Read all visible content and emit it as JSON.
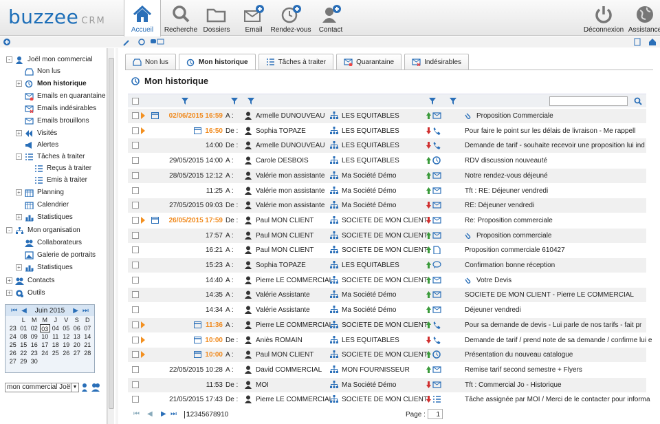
{
  "app": {
    "logo": "buzzee",
    "logo_suffix": "CRM"
  },
  "nav": [
    {
      "label": "Accueil",
      "icon": "home-icon"
    },
    {
      "label": "Recherche",
      "icon": "search-icon"
    },
    {
      "label": "Dossiers",
      "icon": "folder-icon"
    },
    {
      "label": "Email",
      "icon": "email-add-icon"
    },
    {
      "label": "Rendez-vous",
      "icon": "clock-add-icon"
    },
    {
      "label": "Contact",
      "icon": "contact-add-icon"
    }
  ],
  "nav_right": [
    {
      "label": "Déconnexion",
      "icon": "power-icon"
    },
    {
      "label": "Assistance",
      "icon": "globe-icon"
    }
  ],
  "sidebar": {
    "items": [
      {
        "label": "Joël mon commercial",
        "level": 0,
        "exp": "-",
        "icon": "user-icon"
      },
      {
        "label": "Non lus",
        "level": 1,
        "exp": "",
        "icon": "inbox-icon"
      },
      {
        "label": "Mon historique",
        "level": 1,
        "exp": "+",
        "icon": "history-icon",
        "bold": true
      },
      {
        "label": "Emails en quarantaine",
        "level": 1,
        "exp": "",
        "icon": "mail-quarantine-icon"
      },
      {
        "label": "Emails indésirables",
        "level": 1,
        "exp": "",
        "icon": "mail-spam-icon"
      },
      {
        "label": "Emails brouillons",
        "level": 1,
        "exp": "",
        "icon": "mail-draft-icon"
      },
      {
        "label": "Visités",
        "level": 1,
        "exp": "+",
        "icon": "back-icon"
      },
      {
        "label": "Alertes",
        "level": 1,
        "exp": "",
        "icon": "megaphone-icon"
      },
      {
        "label": "Tâches à traiter",
        "level": 1,
        "exp": "-",
        "icon": "list-icon"
      },
      {
        "label": "Reçus à traiter",
        "level": 2,
        "exp": "",
        "icon": "list-icon"
      },
      {
        "label": "Emis à traiter",
        "level": 2,
        "exp": "",
        "icon": "list-icon"
      },
      {
        "label": "Planning",
        "level": 1,
        "exp": "+",
        "icon": "calendar-icon"
      },
      {
        "label": "Calendrier",
        "level": 1,
        "exp": "",
        "icon": "calendar-icon"
      },
      {
        "label": "Statistiques",
        "level": 1,
        "exp": "+",
        "icon": "stats-icon"
      },
      {
        "label": "Mon organisation",
        "level": 0,
        "exp": "-",
        "icon": "org-icon"
      },
      {
        "label": "Collaborateurs",
        "level": 1,
        "exp": "",
        "icon": "users-icon"
      },
      {
        "label": "Galerie de portraits",
        "level": 1,
        "exp": "",
        "icon": "gallery-icon"
      },
      {
        "label": "Statistiques",
        "level": 1,
        "exp": "+",
        "icon": "stats-icon"
      },
      {
        "label": "Contacts",
        "level": 0,
        "exp": "+",
        "icon": "contacts-icon"
      },
      {
        "label": "Outils",
        "level": 0,
        "exp": "+",
        "icon": "tools-icon"
      }
    ],
    "calendar": {
      "month": "Juin 2015",
      "days": [
        "L",
        "M",
        "M",
        "J",
        "V",
        "S",
        "D"
      ],
      "weeks": [
        [
          "23",
          "01",
          "02",
          "03",
          "04",
          "05",
          "06",
          "07"
        ],
        [
          "24",
          "08",
          "09",
          "10",
          "11",
          "12",
          "13",
          "14"
        ],
        [
          "25",
          "15",
          "16",
          "17",
          "18",
          "19",
          "20",
          "21"
        ],
        [
          "26",
          "22",
          "23",
          "24",
          "25",
          "26",
          "27",
          "28"
        ],
        [
          "27",
          "29",
          "30",
          "",
          "",
          "",
          "",
          ""
        ]
      ],
      "selected": "03"
    },
    "user_select": "mon commercial Joël"
  },
  "tabs": [
    {
      "label": "Non lus",
      "icon": "inbox-icon"
    },
    {
      "label": "Mon historique",
      "icon": "history-icon",
      "active": true
    },
    {
      "label": "Tâches à traiter",
      "icon": "list-icon"
    },
    {
      "label": "Quarantaine",
      "icon": "mail-quarantine-icon"
    },
    {
      "label": "Indésirables",
      "icon": "mail-spam-icon"
    }
  ],
  "page_title": "Mon historique",
  "rows": [
    {
      "arrow": true,
      "date": "02/06/2015 16:59",
      "hl": true,
      "cal": true,
      "dir": "A :",
      "name": "Armelle DUNOUVEAU",
      "company": "LES EQUITABLES",
      "updown": "up",
      "type": "mail",
      "clip": true,
      "subject": "Proposition Commerciale"
    },
    {
      "arrow": true,
      "date": "16:50",
      "hl": true,
      "cal": true,
      "dir": "De :",
      "name": "Sophia TOPAZE",
      "company": "LES EQUITABLES",
      "updown": "down",
      "type": "phone",
      "subject": "Pour faire le point sur les délais de livraison - Me rappell"
    },
    {
      "date": "14:00",
      "dir": "De :",
      "name": "Armelle DUNOUVEAU",
      "company": "LES EQUITABLES",
      "updown": "down",
      "type": "phone",
      "subject": "Demande de tarif - souhaite recevoir une proposition lui ind"
    },
    {
      "date": "29/05/2015 14:00",
      "dir": "A :",
      "name": "Carole DESBOIS",
      "company": "LES EQUITABLES",
      "updown": "up",
      "type": "clock",
      "subject": "RDV discussion nouveauté"
    },
    {
      "date": "28/05/2015 12:12",
      "dir": "A :",
      "name": "Valérie mon assistante",
      "company": "Ma Société Démo",
      "updown": "up",
      "type": "mail",
      "subject": "Notre rendez-vous déjeuné"
    },
    {
      "date": "11:25",
      "dir": "A :",
      "name": "Valérie mon assistante",
      "company": "Ma Société Démo",
      "updown": "up",
      "type": "mail",
      "subject": "Tft : RE: Déjeuner vendredi"
    },
    {
      "date": "27/05/2015 09:03",
      "dir": "De :",
      "name": "Valérie mon assistante",
      "company": "Ma Société Démo",
      "updown": "down",
      "type": "mail",
      "subject": "RE: Déjeuner vendredi"
    },
    {
      "arrow": true,
      "date": "26/05/2015 17:59",
      "hl": true,
      "cal": true,
      "dir": "De :",
      "name": "Paul MON CLIENT",
      "company": "SOCIETE DE MON CLIENT",
      "updown": "down",
      "type": "mail",
      "subject": "Re: Proposition commerciale"
    },
    {
      "date": "17:57",
      "dir": "A :",
      "name": "Paul MON CLIENT",
      "company": "SOCIETE DE MON CLIENT",
      "updown": "up",
      "type": "mail",
      "clip": true,
      "subject": "Proposition commerciale"
    },
    {
      "date": "16:21",
      "dir": "A :",
      "name": "Paul MON CLIENT",
      "company": "SOCIETE DE MON CLIENT",
      "updown": "up",
      "type": "doc",
      "subject": "Proposition commerciale 610427"
    },
    {
      "date": "15:23",
      "dir": "A :",
      "name": "Sophia TOPAZE",
      "company": "LES EQUITABLES",
      "updown": "up",
      "type": "chat",
      "subject": "Confirmation bonne réception"
    },
    {
      "date": "14:40",
      "dir": "A :",
      "name": "Pierre LE COMMERCIAL",
      "company": "SOCIETE DE MON CLIENT",
      "updown": "up",
      "type": "mail",
      "clip": true,
      "subject": "Votre Devis"
    },
    {
      "date": "14:35",
      "dir": "A :",
      "name": "Valérie Assistante",
      "company": "Ma Société Démo",
      "updown": "up",
      "type": "mail",
      "subject": "SOCIETE DE MON CLIENT - Pierre LE COMMERCIAL"
    },
    {
      "date": "14:34",
      "dir": "A :",
      "name": "Valérie Assistante",
      "company": "Ma Société Démo",
      "updown": "up",
      "type": "mail",
      "subject": "Déjeuner vendredi"
    },
    {
      "arrow": true,
      "date": "11:36",
      "hl": true,
      "cal": true,
      "dir": "A :",
      "name": "Pierre LE COMMERCIAL",
      "company": "SOCIETE DE MON CLIENT",
      "updown": "up",
      "type": "phone",
      "subject": "Pour sa demande de devis - Lui parle de nos tarifs - fait pr"
    },
    {
      "arrow": true,
      "date": "10:00",
      "hl": true,
      "cal": true,
      "dir": "De :",
      "name": "Aniès ROMAIN",
      "company": "LES EQUITABLES",
      "updown": "down",
      "type": "phone",
      "subject": "Demande de tarif / prend note de sa demande / confirme lui e"
    },
    {
      "arrow": true,
      "date": "10:00",
      "hl": true,
      "cal": true,
      "dir": "A :",
      "name": "Paul MON CLIENT",
      "company": "SOCIETE DE MON CLIENT",
      "updown": "up",
      "type": "clock",
      "subject": "Présentation du nouveau catalogue"
    },
    {
      "date": "22/05/2015 10:28",
      "dir": "A :",
      "name": "David COMMERCIAL",
      "company": "MON FOURNISSEUR",
      "updown": "up",
      "type": "mail",
      "subject": "Remise tarif second semestre + Flyers"
    },
    {
      "date": "11:53",
      "dir": "De :",
      "name": "MOI",
      "company": "Ma Société Démo",
      "updown": "down",
      "type": "mail",
      "subject": "Tft : Commercial Jo - Historique"
    },
    {
      "date": "21/05/2015 17:43",
      "dir": "De :",
      "name": "Pierre LE COMMERCIAL",
      "company": "SOCIETE DE MON CLIENT",
      "updown": "down",
      "type": "list",
      "subject": "Tâche assignée par  MOI / Merci de le contacter pour informa"
    }
  ],
  "pager": {
    "pages": [
      "1",
      "2",
      "3",
      "4",
      "5",
      "6",
      "7",
      "8",
      "9",
      "10"
    ],
    "current": "1",
    "page_label": "Page :",
    "page_value": "1"
  },
  "colors": {
    "accent": "#1e6fb8",
    "orange": "#f08a1e",
    "up": "#3a9a3a",
    "down": "#d03030"
  }
}
